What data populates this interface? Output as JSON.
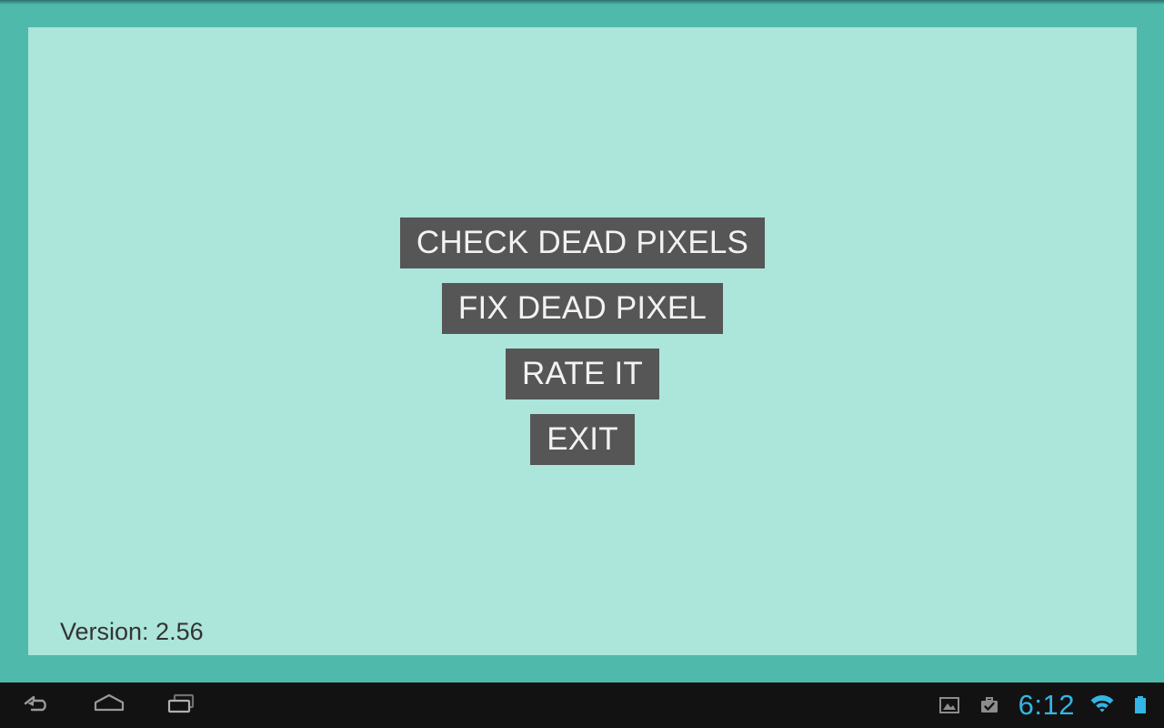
{
  "app": {
    "version_label": "Version: 2.56",
    "background_color": "#4fb9ac",
    "panel_color": "#ace5da",
    "button_color": "#565656",
    "button_text_color": "#f2f2f2"
  },
  "buttons": [
    {
      "label": "CHECK DEAD PIXELS",
      "name": "check-dead-pixels-button"
    },
    {
      "label": "FIX DEAD PIXEL",
      "name": "fix-dead-pixel-button"
    },
    {
      "label": "RATE IT",
      "name": "rate-it-button"
    },
    {
      "label": "EXIT",
      "name": "exit-button"
    }
  ],
  "navbar": {
    "background_color": "#121212",
    "accent_color": "#33b5e5",
    "icon_color": "#9a9a9a",
    "buttons": [
      {
        "name": "back-icon",
        "label": "Back"
      },
      {
        "name": "home-icon",
        "label": "Home"
      },
      {
        "name": "recents-icon",
        "label": "Recent apps"
      }
    ],
    "status": {
      "screenshot_icon": "image-icon",
      "download_icon": "briefcase-check-icon",
      "clock": "6:12",
      "wifi_icon": "wifi-icon",
      "battery_icon": "battery-full-icon"
    }
  }
}
